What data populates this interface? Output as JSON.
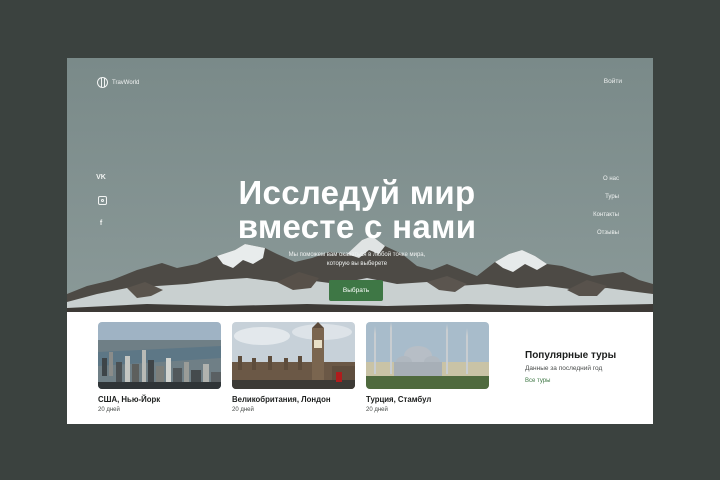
{
  "header": {
    "logo_text": "TravWorld",
    "login_label": "Войти"
  },
  "social": {
    "vk": "VK",
    "instagram": "instagram-icon",
    "facebook": "f"
  },
  "nav": {
    "items": [
      "О нас",
      "Туры",
      "Контакты",
      "Отзывы"
    ]
  },
  "hero": {
    "title_line1": "Исследуй мир",
    "title_line2": "вместе с нами",
    "subtitle_line1": "Мы поможем вам оказаться в любой точке мира,",
    "subtitle_line2": "которую вы выберете",
    "cta_label": "Выбрать"
  },
  "tours": [
    {
      "name": "США, Нью-Йорк",
      "days": "20 дней"
    },
    {
      "name": "Великобритания, Лондон",
      "days": "20 дней"
    },
    {
      "name": "Турция, Стамбул",
      "days": "20 дней"
    }
  ],
  "popular": {
    "heading": "Популярные туры",
    "subheading": "Данные за последний год",
    "link": "Все туры"
  },
  "colors": {
    "background": "#3b423f",
    "hero": "#7b8b8a",
    "accent": "#3e7745"
  }
}
